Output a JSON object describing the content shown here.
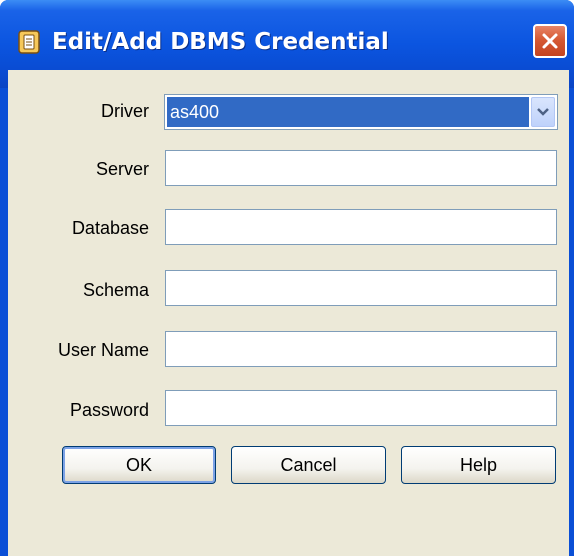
{
  "window": {
    "title": "Edit/Add DBMS Credential"
  },
  "form": {
    "driver": {
      "label": "Driver",
      "value": "as400"
    },
    "server": {
      "label": "Server",
      "value": ""
    },
    "database": {
      "label": "Database",
      "value": ""
    },
    "schema": {
      "label": "Schema",
      "value": ""
    },
    "user_name": {
      "label": "User Name",
      "value": ""
    },
    "password": {
      "label": "Password",
      "value": ""
    }
  },
  "buttons": {
    "ok": "OK",
    "cancel": "Cancel",
    "help": "Help"
  },
  "icons": {
    "title": "app-icon",
    "close": "close-icon",
    "dropdown": "chevron-down-icon"
  },
  "colors": {
    "titlebar": "#0a55e0",
    "dialog_background": "#ece9d8",
    "selection": "#316ac5",
    "close_button": "#d65a34"
  }
}
